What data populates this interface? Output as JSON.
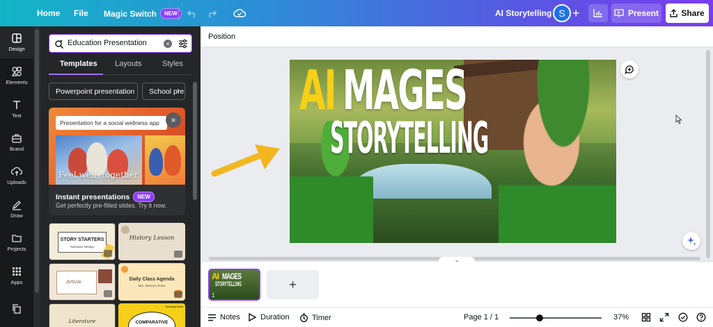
{
  "colors": {
    "accent": "#8b3dff",
    "title_yellow": "#f6cf18",
    "panel_bg": "#252627",
    "rail_bg": "#18191b"
  },
  "topbar": {
    "home": "Home",
    "file": "File",
    "magic_switch": "Magic Switch",
    "new_badge": "NEW",
    "doc_title": "AI Storytelling",
    "avatar_letter": "S",
    "present": "Present",
    "share": "Share"
  },
  "rail": {
    "items": [
      {
        "label": "Design",
        "icon": "layout-icon"
      },
      {
        "label": "Elements",
        "icon": "shapes-icon"
      },
      {
        "label": "Text",
        "icon": "text-icon"
      },
      {
        "label": "Brand",
        "icon": "briefcase-icon"
      },
      {
        "label": "Uploads",
        "icon": "upload-icon"
      },
      {
        "label": "Draw",
        "icon": "pen-icon"
      },
      {
        "label": "Projects",
        "icon": "folder-icon"
      },
      {
        "label": "Apps",
        "icon": "grid-icon"
      }
    ]
  },
  "panel": {
    "search_value": "Education Presentation",
    "tabs": [
      "Templates",
      "Layouts",
      "Styles"
    ],
    "chips": [
      "Powerpoint presentation",
      "School pre"
    ],
    "promo": {
      "input_text": "Presentation for a social wellness app",
      "slide_caption": "Feel well, together",
      "title": "Instant presentations",
      "badge": "NEW",
      "subtitle": "Get perfectly pre-filled slides. Try it now."
    },
    "templates": [
      {
        "title": "STORY STARTERS",
        "sub": "Narrative Writing"
      },
      {
        "title": "History Lesson",
        "sub": ""
      },
      {
        "title": "Article",
        "sub": ""
      },
      {
        "title": "Daily Class Agenda",
        "sub": "Mrs. Danny's Class"
      },
      {
        "title": "Literature",
        "sub": ""
      },
      {
        "title": "COMPARATIVE",
        "sub": "Guessing Game"
      }
    ]
  },
  "canvas": {
    "context_label": "Position",
    "slide_text": {
      "word1": "AI",
      "word2": "MAGES",
      "word3": "STORYTELLING"
    }
  },
  "strip": {
    "page_number": "1",
    "add_label": "+"
  },
  "footer": {
    "notes": "Notes",
    "duration": "Duration",
    "timer": "Timer",
    "page_indicator": "Page 1 / 1",
    "zoom": "37%"
  }
}
